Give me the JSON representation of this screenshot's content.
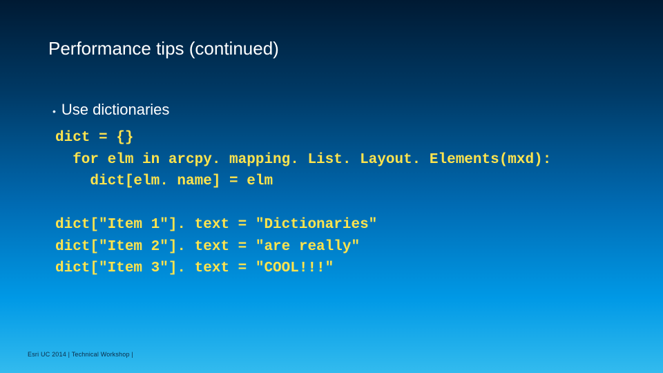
{
  "title": "Performance tips (continued)",
  "bullet": "Use dictionaries",
  "code": {
    "l1": "dict = {}",
    "l2": "  for elm in arcpy. mapping. List. Layout. Elements(mxd):",
    "l3": "    dict[elm. name] = elm",
    "l4": "",
    "l5": "dict[\"Item 1\"]. text = \"Dictionaries\"",
    "l6": "dict[\"Item 2\"]. text = \"are really\"",
    "l7": "dict[\"Item 3\"]. text = \"COOL!!!\""
  },
  "footer": "Esri UC 2014 | Technical Workshop |"
}
